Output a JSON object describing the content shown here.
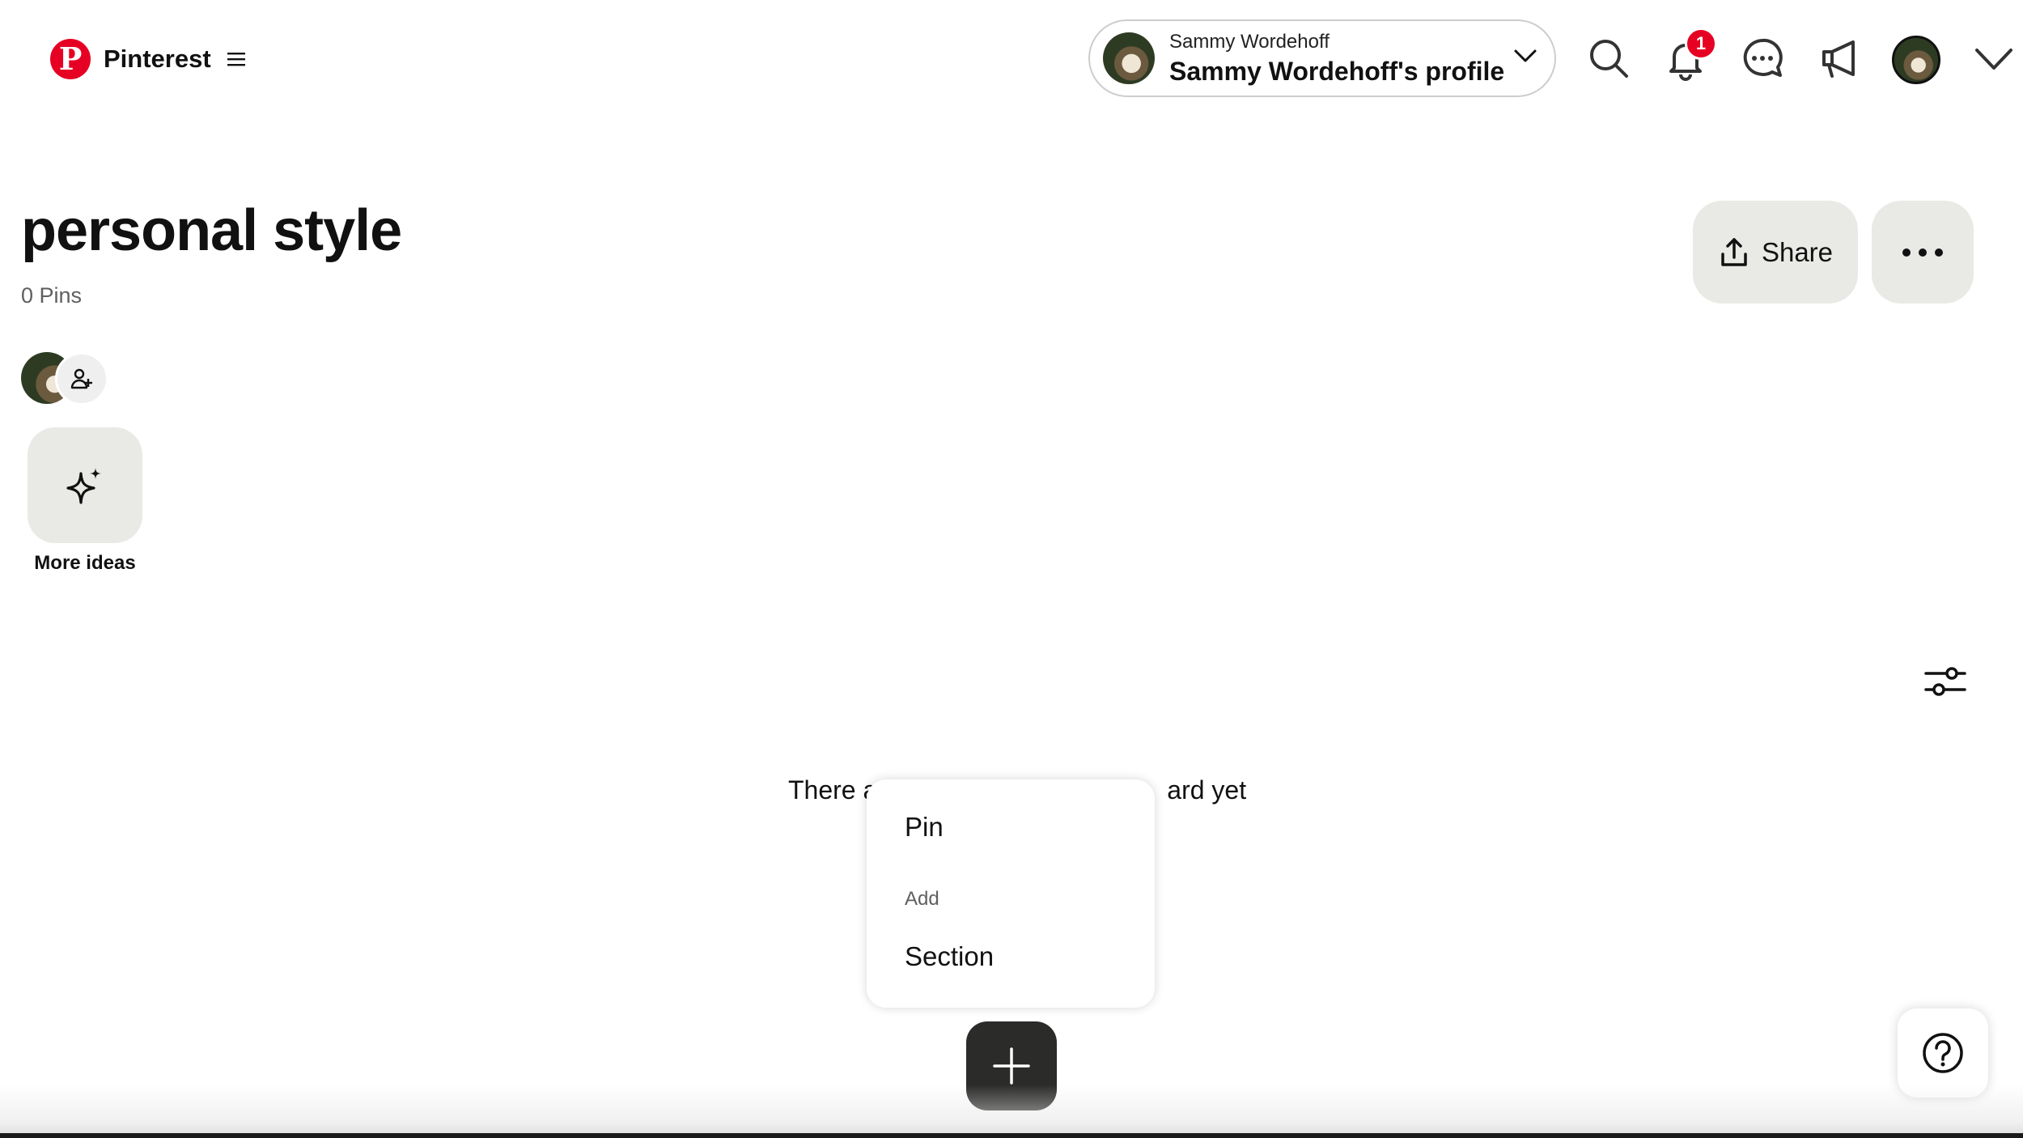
{
  "header": {
    "brand": "Pinterest",
    "logo_letter": "P",
    "profile_switcher": {
      "account_name": "Sammy Wordehoff",
      "profile_label": "Sammy Wordehoff's profile"
    },
    "notification_count": "1",
    "icons": [
      "search-icon",
      "bell-icon",
      "messages-icon",
      "megaphone-icon",
      "avatar",
      "chevron-down-icon"
    ]
  },
  "board": {
    "title": "personal style",
    "pin_count": "0 Pins",
    "share_label": "Share",
    "more_ideas_label": "More ideas"
  },
  "empty_state": {
    "visible_left": "There a",
    "visible_right": "ard yet"
  },
  "popup_menu": {
    "first_item": "Pin",
    "group_label": "Add",
    "second_item": "Section"
  },
  "colors": {
    "brand_red": "#e60023",
    "button_gray": "#e9e9e6",
    "fab_dark": "#2b2b29"
  }
}
